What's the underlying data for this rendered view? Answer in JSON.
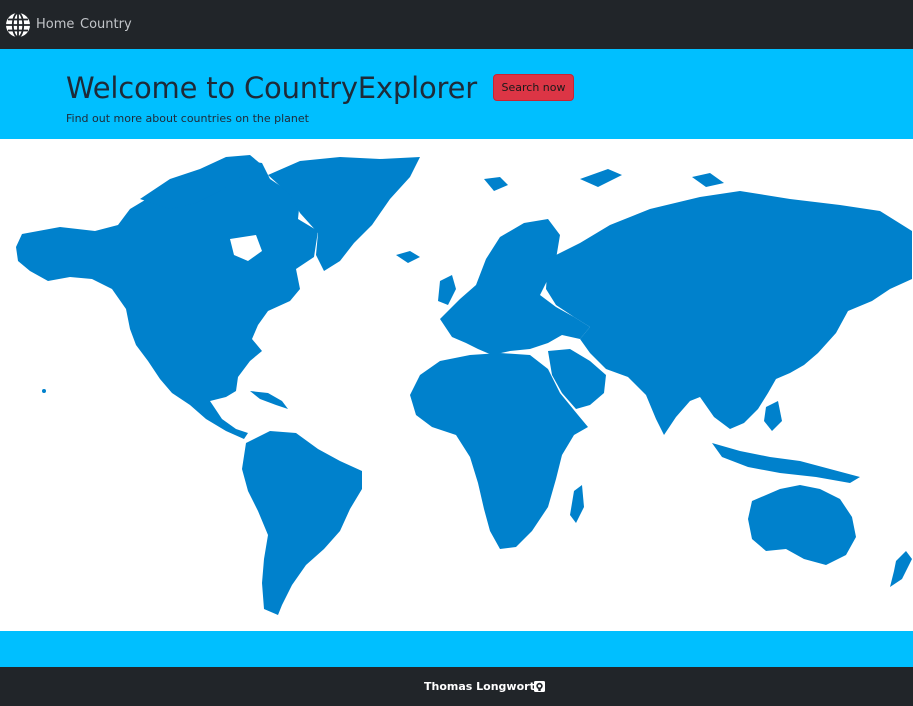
{
  "navbar": {
    "brand_icon": "globe-icon",
    "links": [
      {
        "label": "Home"
      },
      {
        "label": "Country"
      }
    ]
  },
  "hero": {
    "title": "Welcome to CountryExplorer",
    "button_label": "Search now",
    "subtitle": "Find out more about countries on the planet"
  },
  "map": {
    "icon": "world-map",
    "land_color": "#0081cc"
  },
  "footer": {
    "author": "Thomas Longworth",
    "icon": "github-icon"
  },
  "colors": {
    "navbar": "#212529",
    "hero": "#00bfff",
    "button": "#dc3545"
  }
}
